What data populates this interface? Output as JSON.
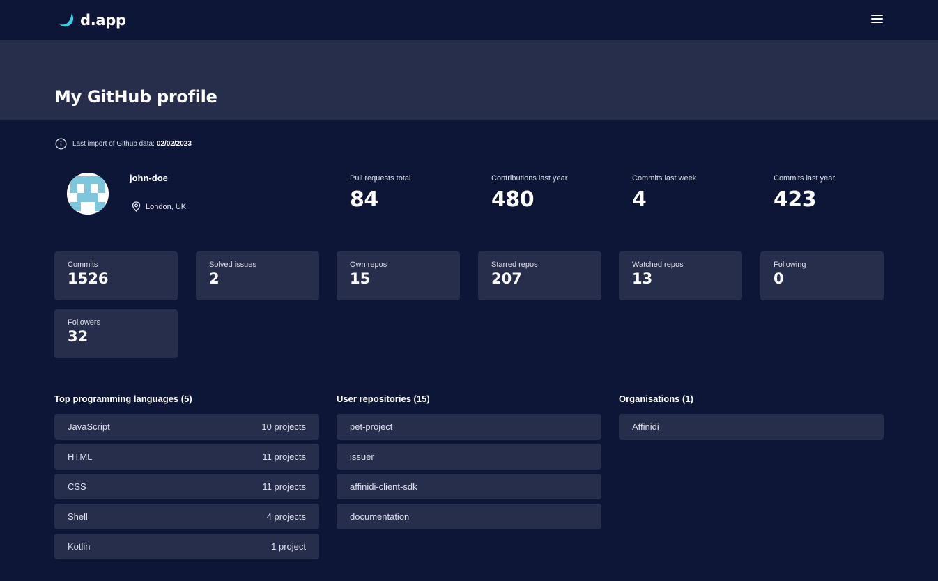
{
  "header": {
    "app_name": "d.app",
    "brand_color": "#3ad0e6",
    "menu_icon": "hamburger-menu-icon"
  },
  "page": {
    "title": "My GitHub profile"
  },
  "import_note": {
    "text": "Last import of Github data:",
    "date": "02/02/2023"
  },
  "profile": {
    "username": "john-doe",
    "location": "London, UK"
  },
  "headline_stats": [
    {
      "label": "Pull requests total",
      "value": "84"
    },
    {
      "label": "Contributions last year",
      "value": "480"
    },
    {
      "label": "Commits last week",
      "value": "4"
    },
    {
      "label": "Commits last year",
      "value": "423"
    }
  ],
  "stat_cards": [
    {
      "label": "Commits",
      "value": "1526"
    },
    {
      "label": "Solved issues",
      "value": "2"
    },
    {
      "label": "Own repos",
      "value": "15"
    },
    {
      "label": "Starred repos",
      "value": "207"
    },
    {
      "label": "Watched repos",
      "value": "13"
    },
    {
      "label": "Following",
      "value": "0"
    },
    {
      "label": "Followers",
      "value": "32"
    }
  ],
  "languages": {
    "title": "Top programming languages (5)",
    "items": [
      {
        "name": "JavaScript",
        "count": "10 projects"
      },
      {
        "name": "HTML",
        "count": "11 projects"
      },
      {
        "name": "CSS",
        "count": "11 projects"
      },
      {
        "name": "Shell",
        "count": "4 projects"
      },
      {
        "name": "Kotlin",
        "count": "1 project"
      }
    ]
  },
  "repositories": {
    "title": "User repositories (15)",
    "items": [
      {
        "name": "pet-project"
      },
      {
        "name": "issuer"
      },
      {
        "name": "affinidi-client-sdk"
      },
      {
        "name": "documentation"
      }
    ]
  },
  "organisations": {
    "title": "Organisations (1)",
    "items": [
      {
        "name": "Affinidi"
      }
    ]
  },
  "colors": {
    "background": "#0e1637",
    "panel": "#272e4b",
    "avatar_pattern": "#7ec6dc"
  }
}
